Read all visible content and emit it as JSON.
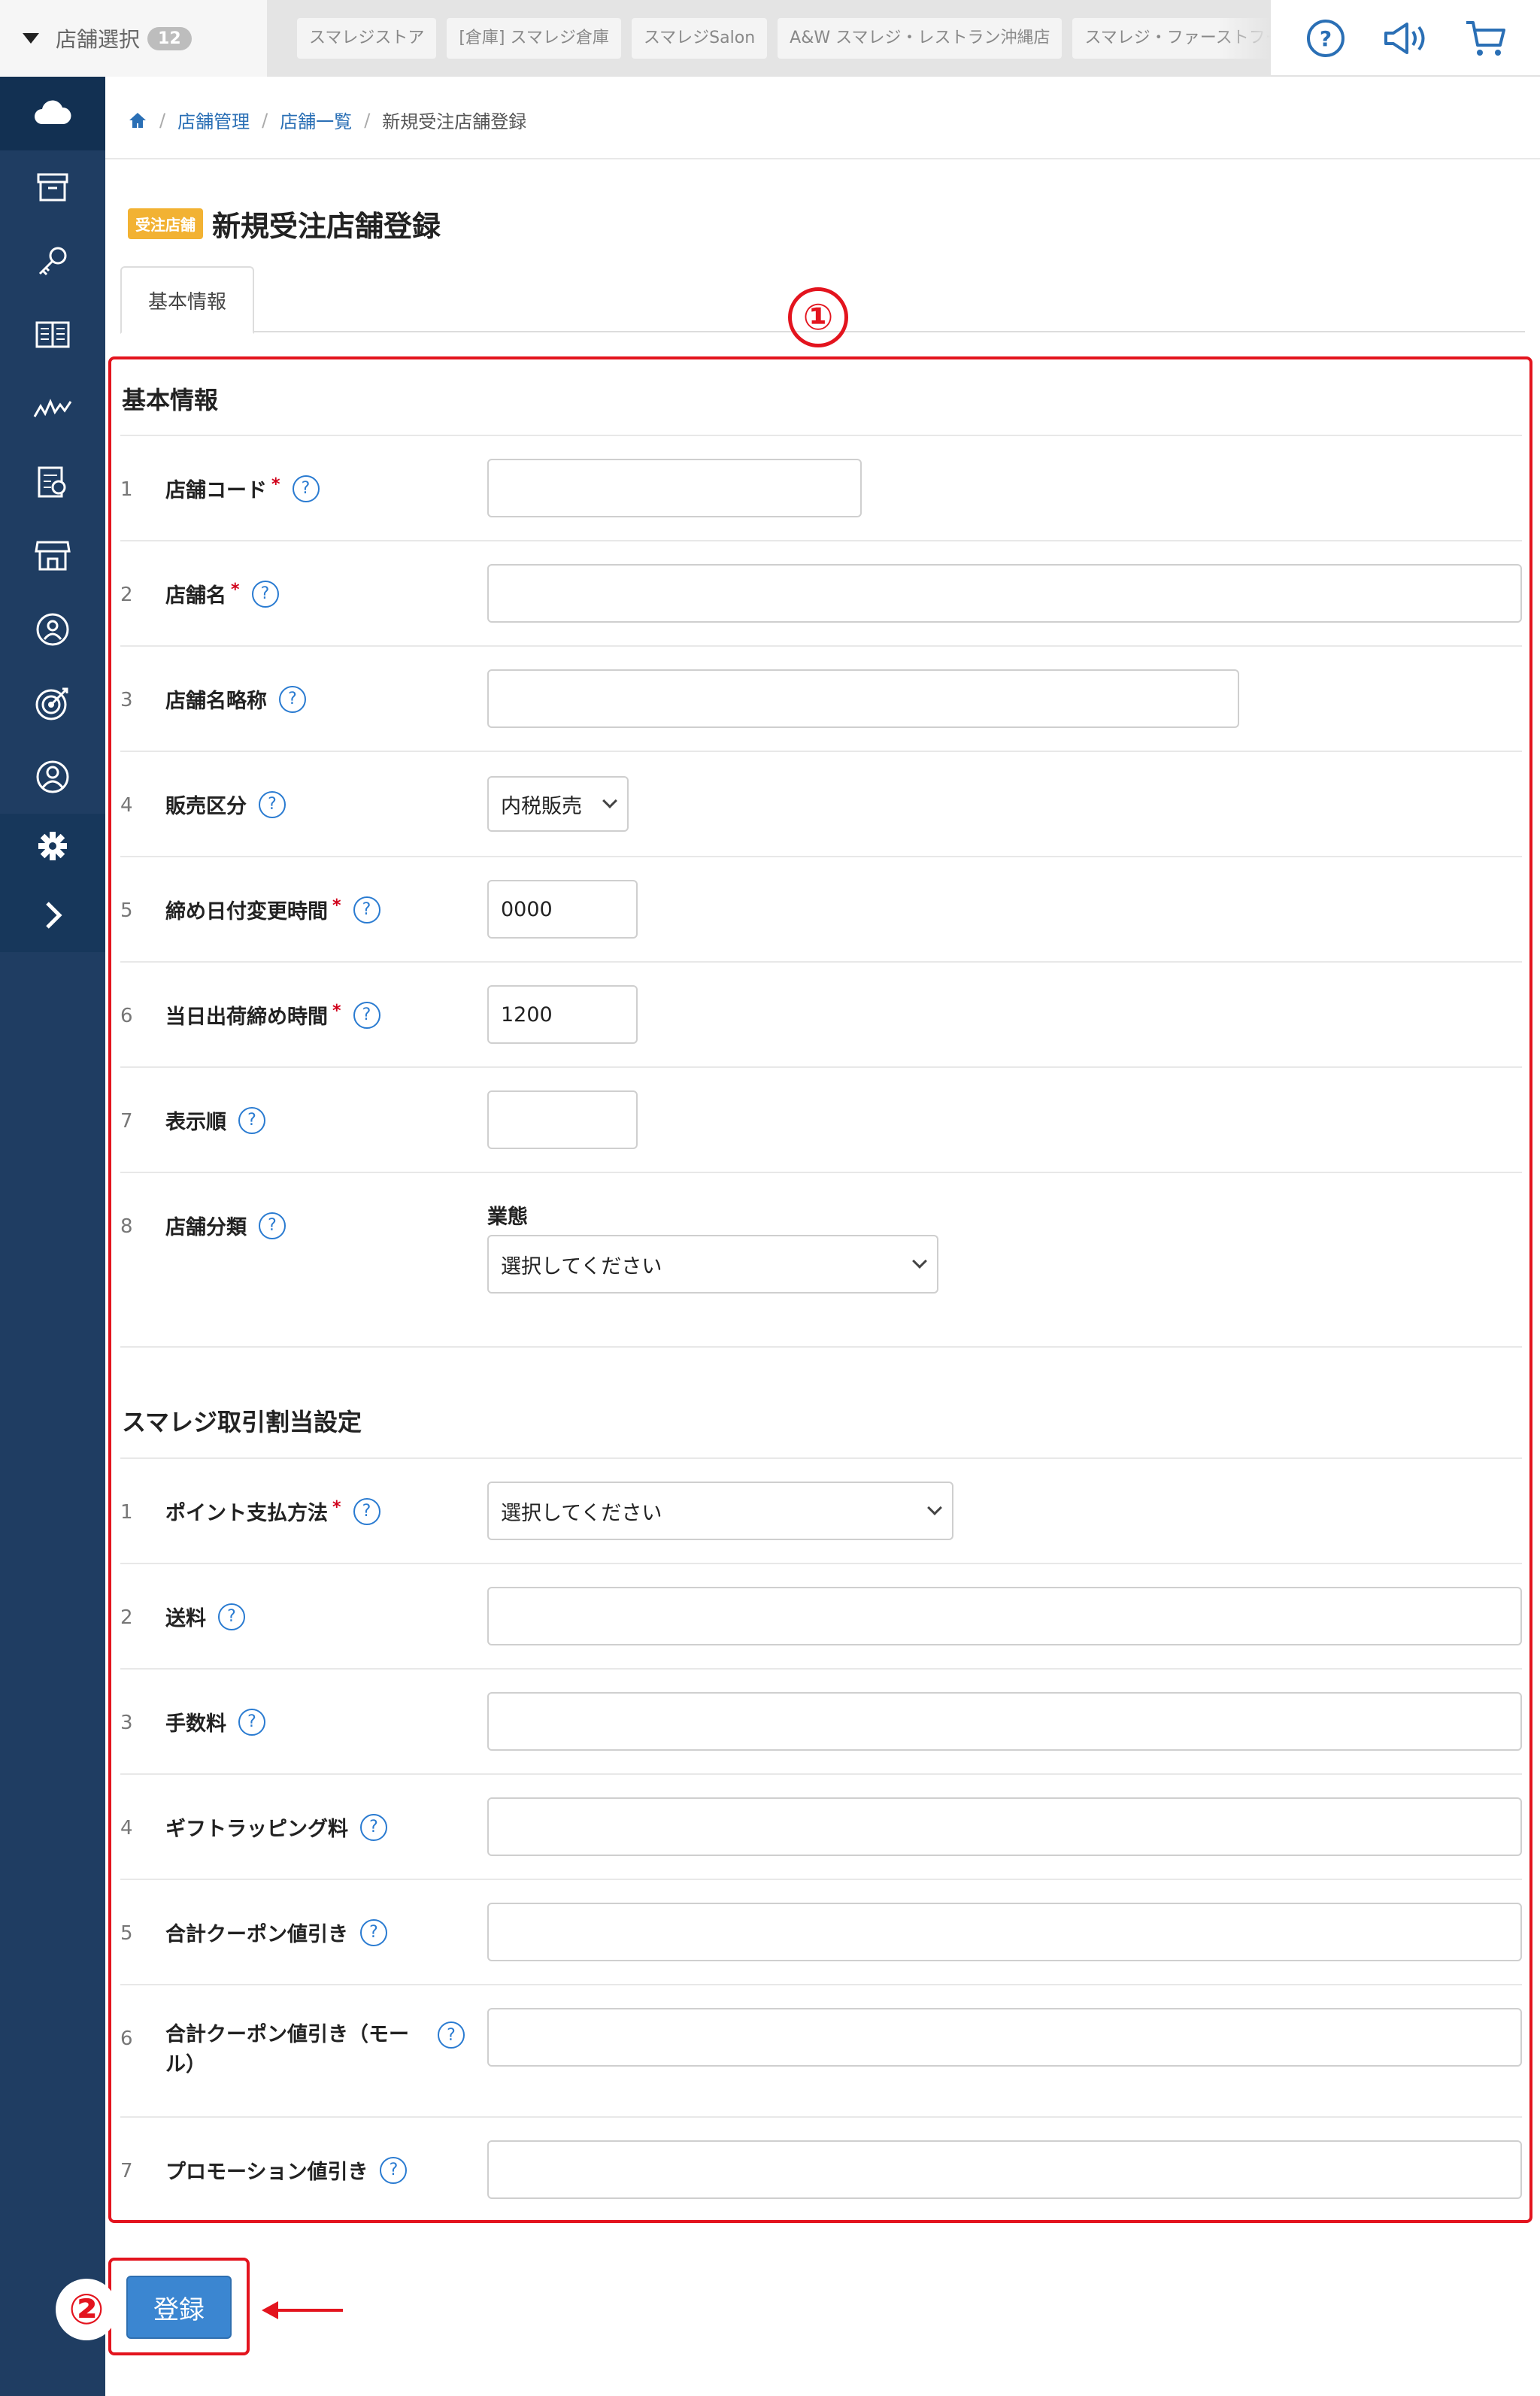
{
  "topbar": {
    "store_select_label": "店舗選択",
    "store_count": "12",
    "stores": [
      "スマレジストア",
      "[倉庫] スマレジ倉庫",
      "スマレジSalon",
      "A&W スマレジ・レストラン沖縄店",
      "スマレジ・ファーストフード"
    ],
    "icons": [
      "help-circle-icon",
      "megaphone-icon",
      "cart-icon"
    ]
  },
  "sidebar": {
    "icons": [
      "cloud-icon",
      "archive-box-icon",
      "key-icon",
      "book-icon",
      "chart-line-icon",
      "ledger-icon",
      "storefront-icon",
      "user-badge-icon",
      "target-icon",
      "user-circle-icon",
      "gear-icon",
      "chevron-right-icon"
    ]
  },
  "breadcrumb": {
    "home_icon": "home-icon",
    "items": [
      "店舗管理",
      "店舗一覧",
      "新規受注店舗登録"
    ]
  },
  "page": {
    "badge": "受注店舗",
    "title": "新規受注店舗登録",
    "tab": "基本情報"
  },
  "basic_info": {
    "section_title": "基本情報",
    "rows": [
      {
        "num": "1",
        "label": "店舗コード",
        "required": "*",
        "value": ""
      },
      {
        "num": "2",
        "label": "店舗名",
        "required": "*",
        "value": ""
      },
      {
        "num": "3",
        "label": "店舗名略称",
        "required": "",
        "value": ""
      },
      {
        "num": "4",
        "label": "販売区分",
        "required": "",
        "value": "内税販売"
      },
      {
        "num": "5",
        "label": "締め日付変更時間",
        "required": "*",
        "value": "0000"
      },
      {
        "num": "6",
        "label": "当日出荷締め時間",
        "required": "*",
        "value": "1200"
      },
      {
        "num": "7",
        "label": "表示順",
        "required": "",
        "value": ""
      },
      {
        "num": "8",
        "label": "店舗分類",
        "required": "",
        "sub_label": "業態",
        "value": "選択してください"
      }
    ]
  },
  "smaregi_settings": {
    "section_title": "スマレジ取引割当設定",
    "rows": [
      {
        "num": "1",
        "label": "ポイント支払方法",
        "required": "*",
        "value": "選択してください"
      },
      {
        "num": "2",
        "label": "送料",
        "required": "",
        "value": ""
      },
      {
        "num": "3",
        "label": "手数料",
        "required": "",
        "value": ""
      },
      {
        "num": "4",
        "label": "ギフトラッピング料",
        "required": "",
        "value": ""
      },
      {
        "num": "5",
        "label": "合計クーポン値引き",
        "required": "",
        "value": ""
      },
      {
        "num": "6",
        "label": "合計クーポン値引き（モー",
        "label_line2": "ル）",
        "required": "",
        "value": ""
      },
      {
        "num": "7",
        "label": "プロモーション値引き",
        "required": "",
        "value": ""
      }
    ]
  },
  "help_glyph": "?",
  "submit_label": "登録",
  "annotations": {
    "box1": "①",
    "box2": "②"
  },
  "colors": {
    "sidebar": "#1f3d62",
    "annotation": "#e3141e",
    "primary_button": "#3b86d1",
    "badge": "#f2b233",
    "help_icon": "#2a7bd1"
  }
}
